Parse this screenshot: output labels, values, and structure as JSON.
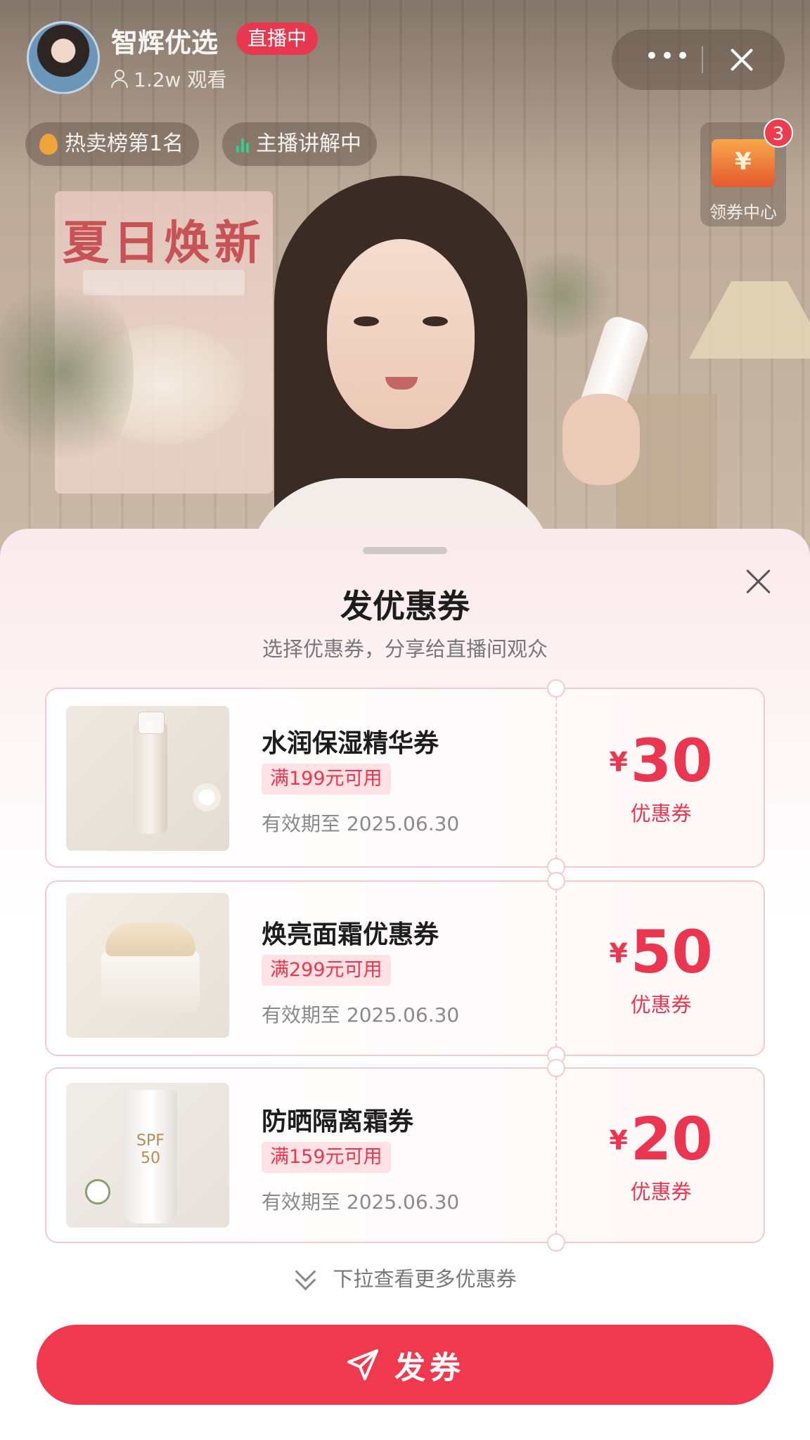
{
  "stream": {
    "streamer_name": "智辉优选",
    "live_badge": "直播中",
    "viewers": "1.2w 观看",
    "tags": [
      "热卖榜第1名",
      "主播讲解中"
    ],
    "coupon_center_label": "领券中心",
    "coupon_center_badge": "3",
    "poster_title": "夏日焕新"
  },
  "sheet": {
    "title": "发优惠券",
    "subtitle": "选择优惠券，分享给直播间观众",
    "coupons": [
      {
        "name": "水润保湿精华券",
        "condition": "满199元可用",
        "validity": "有效期至 2025.06.30",
        "currency": "¥",
        "amount": "30",
        "unit": "优惠券",
        "image": "serum-bottle"
      },
      {
        "name": "焕亮面霜优惠券",
        "condition": "满299元可用",
        "validity": "有效期至 2025.06.30",
        "currency": "¥",
        "amount": "50",
        "unit": "优惠券",
        "image": "cream-jar"
      },
      {
        "name": "防晒隔离霜券",
        "condition": "满159元可用",
        "validity": "有效期至 2025.06.30",
        "currency": "¥",
        "amount": "20",
        "unit": "优惠券",
        "image": "sunscreen-tube"
      }
    ],
    "more_hint": "下拉查看更多优惠券",
    "send_button": "发券"
  },
  "colors": {
    "accent": "#f0384f",
    "coupon_border": "#f6c9cf",
    "tag_bg": "#fde1e4"
  },
  "icons": [
    "user-icon",
    "more-icon",
    "close-icon",
    "fire-icon",
    "wave-icon",
    "coupon-center-icon",
    "chevron-down-icon",
    "send-icon"
  ]
}
